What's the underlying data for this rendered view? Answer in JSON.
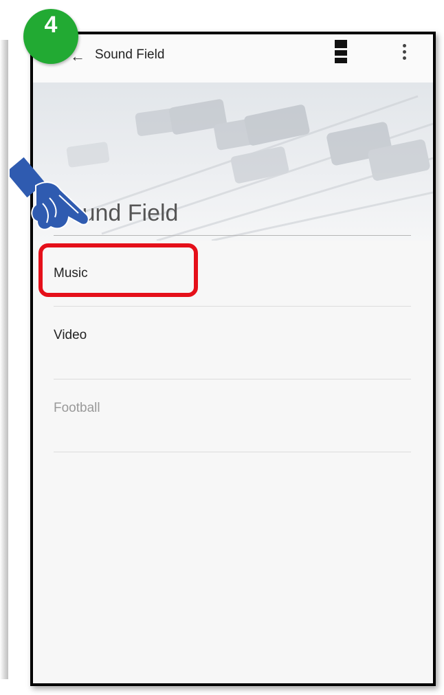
{
  "step_badge": "4",
  "appbar": {
    "title": "Sound Field",
    "back_icon": "arrow-left-icon",
    "menu_icon": "hamburger-icon",
    "more_icon": "more-vertical-icon"
  },
  "header": {
    "title": "Sound Field",
    "image": "mixing-console-sliders"
  },
  "list": {
    "items": [
      {
        "label": "Music",
        "enabled": true,
        "highlighted": true
      },
      {
        "label": "Video",
        "enabled": true,
        "highlighted": false
      },
      {
        "label": "Football",
        "enabled": false,
        "highlighted": false
      }
    ]
  },
  "colors": {
    "badge": "#22aa33",
    "highlight": "#e5101a",
    "pointer": "#2f5bb0"
  }
}
